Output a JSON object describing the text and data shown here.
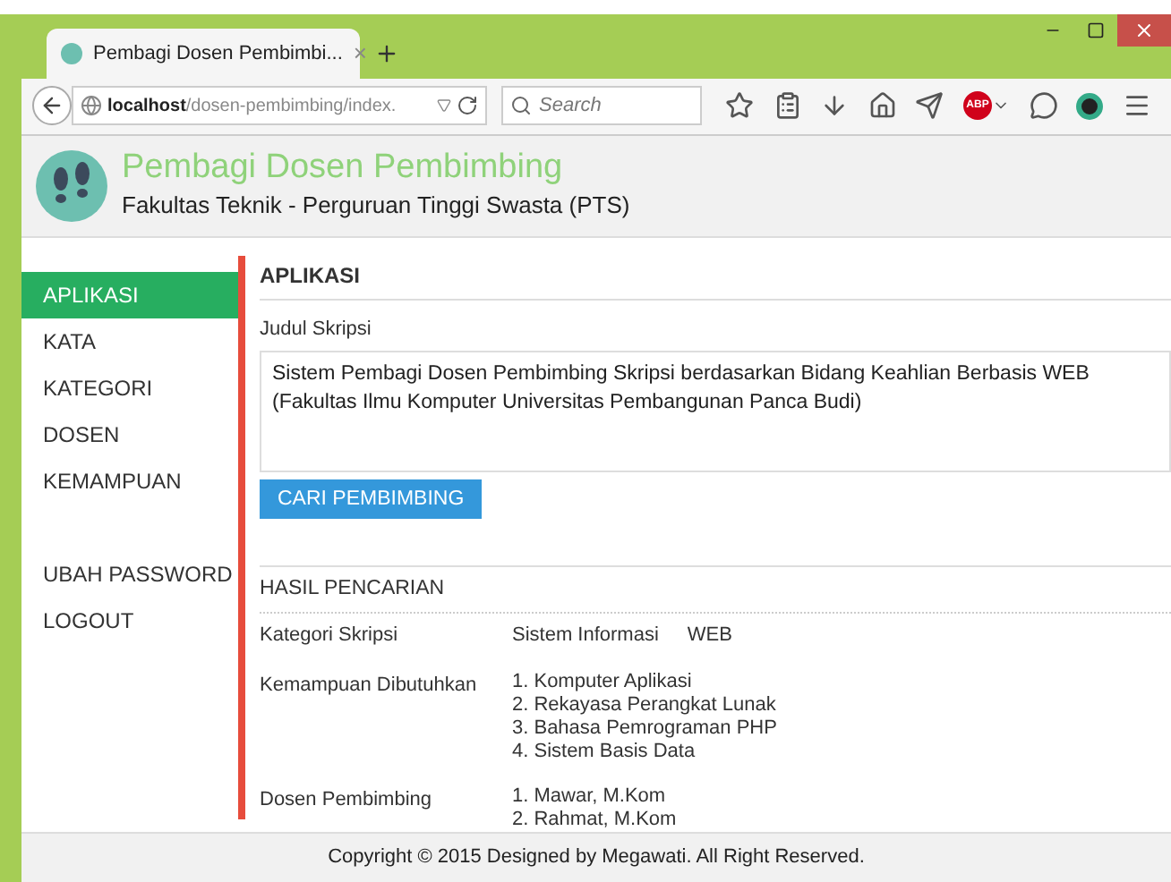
{
  "browser": {
    "tab_title": "Pembagi Dosen Pembimbi...",
    "close_glyph": "×",
    "url_host": "localhost",
    "url_path": "/dosen-pembimbing/index.",
    "search_placeholder": "Search",
    "adblock_badge": "ABP"
  },
  "header": {
    "title": "Pembagi Dosen Pembimbing",
    "subtitle": "Fakultas Teknik - Perguruan Tinggi Swasta (PTS)"
  },
  "sidebar": {
    "items": [
      {
        "label": "APLIKASI",
        "selected": true
      },
      {
        "label": "KATA",
        "selected": false
      },
      {
        "label": "KATEGORI",
        "selected": false
      },
      {
        "label": "DOSEN",
        "selected": false
      },
      {
        "label": "KEMAMPUAN",
        "selected": false
      }
    ],
    "account_items": [
      {
        "label": "UBAH PASSWORD",
        "selected": false
      },
      {
        "label": "LOGOUT",
        "selected": false
      }
    ]
  },
  "main": {
    "heading": "APLIKASI",
    "field_label": "Judul Skripsi",
    "field_value": "Sistem Pembagi Dosen Pembimbing Skripsi berdasarkan Bidang Keahlian Berbasis WEB (Fakultas Ilmu Komputer Universitas Pembangunan Panca Budi)",
    "button": "CARI PEMBIMBING"
  },
  "results": {
    "heading": "HASIL PENCARIAN",
    "rows": [
      {
        "label": "Kategori Skripsi",
        "kind": "inline",
        "values": [
          "Sistem Informasi",
          "WEB"
        ]
      },
      {
        "label": "Kemampuan Dibutuhkan",
        "kind": "list",
        "values": [
          "1. Komputer Aplikasi",
          "2. Rekayasa Perangkat Lunak",
          "3. Bahasa Pemrograman PHP",
          "4. Sistem Basis Data"
        ]
      },
      {
        "label": "Dosen Pembimbing",
        "kind": "list",
        "values": [
          "1. Mawar, M.Kom",
          "2. Rahmat, M.Kom"
        ]
      }
    ]
  },
  "footer": "Copyright © 2015 Designed by Megawati. All Right Reserved."
}
